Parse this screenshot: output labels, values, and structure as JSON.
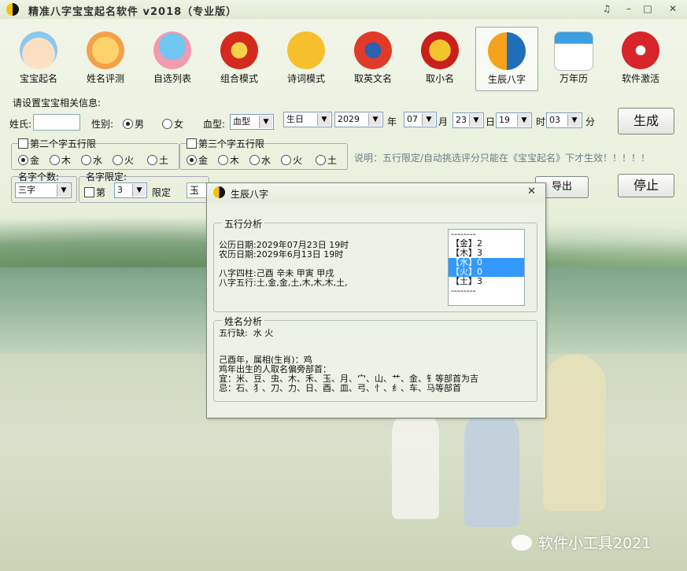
{
  "window": {
    "title": "精准八字宝宝起名软件 v2018（专业版）",
    "controls": [
      "♫",
      "–",
      "□",
      "✕"
    ]
  },
  "toolbar": [
    {
      "label": "宝宝起名",
      "icon": "baby-face-icon"
    },
    {
      "label": "姓名评测",
      "icon": "score-100-icon"
    },
    {
      "label": "自选列表",
      "icon": "bird-reading-icon"
    },
    {
      "label": "组合模式",
      "icon": "lantern-icon"
    },
    {
      "label": "诗词模式",
      "icon": "book-icon"
    },
    {
      "label": "取英文名",
      "icon": "eagle-emblem-icon"
    },
    {
      "label": "取小名",
      "icon": "mask-icon"
    },
    {
      "label": "生辰八字",
      "icon": "yin-yang-icon"
    },
    {
      "label": "万年历",
      "icon": "calendar-365-icon"
    },
    {
      "label": "软件激活",
      "icon": "lock-icon"
    }
  ],
  "form": {
    "section_title": "请设置宝宝相关信息:",
    "surname_label": "姓氏:",
    "surname_value": "",
    "gender_label": "性别:",
    "gender_male": "男",
    "gender_female": "女",
    "blood_label": "血型:",
    "blood_value": "血型",
    "birthday_select": "生日",
    "year_value": "2029",
    "year_unit": "年",
    "month_value": "07",
    "month_unit": "月",
    "day_value": "23",
    "day_unit": "日",
    "hour_value": "19",
    "hour_unit": "时",
    "minute_value": "03",
    "minute_unit": "分",
    "generate_button": "生成",
    "stop_button": "停止",
    "export_button": "导出",
    "second_wuxing_label": "第二个字五行限",
    "third_wuxing_label": "第三个字五行限",
    "wuxing_options": [
      "金",
      "木",
      "水",
      "火",
      "土"
    ],
    "note": "说明：五行限定/自动挑选评分只能在《宝宝起名》下才生效！！！！！",
    "name_count_label": "名字个数:",
    "name_count_value": "三字",
    "name_limit_label": "名字限定:",
    "position_prefix": "第",
    "position_value": "3",
    "limit_label": "限定",
    "limit_value": "玉"
  },
  "dialog": {
    "title": "生辰八字",
    "close": "✕",
    "wuxing_section": "五行分析",
    "solar_date": "公历日期:2029年07月23日 19时",
    "lunar_date": "农历日期:2029年6月13日 19时",
    "bazi_pillars": "八字四柱:己酉 辛未 甲寅 甲戌",
    "bazi_wuxing": "八字五行:土,金,金,土,木,木,木,土,",
    "element_list": [
      {
        "text": "--------",
        "selected": false
      },
      {
        "text": "【金】2",
        "selected": false
      },
      {
        "text": "【木】3",
        "selected": false
      },
      {
        "text": "【水】0",
        "selected": true
      },
      {
        "text": "【火】0",
        "selected": true
      },
      {
        "text": "【土】3",
        "selected": false
      },
      {
        "text": "--------",
        "selected": false
      }
    ],
    "name_section": "姓名分析",
    "missing_elements": "五行缺:  水 火",
    "zodiac_line": "己酉年，属相(生肖)：鸡",
    "zodiac_radicals": "鸡年出生的人取名偏旁部首：",
    "good_radicals": "宜：米、豆、虫、木、禾、玉、月、宀、山、艹、金、钅等部首为吉",
    "bad_radicals": "忌：石、犭、刀、力、日、酉、皿、弓、忄、纟、车、马等部首"
  },
  "watermark": "软件小工具2021",
  "colors": {
    "selection": "#3399ff",
    "background_top": "#f2f6ea",
    "lake": "#6f9a78"
  }
}
